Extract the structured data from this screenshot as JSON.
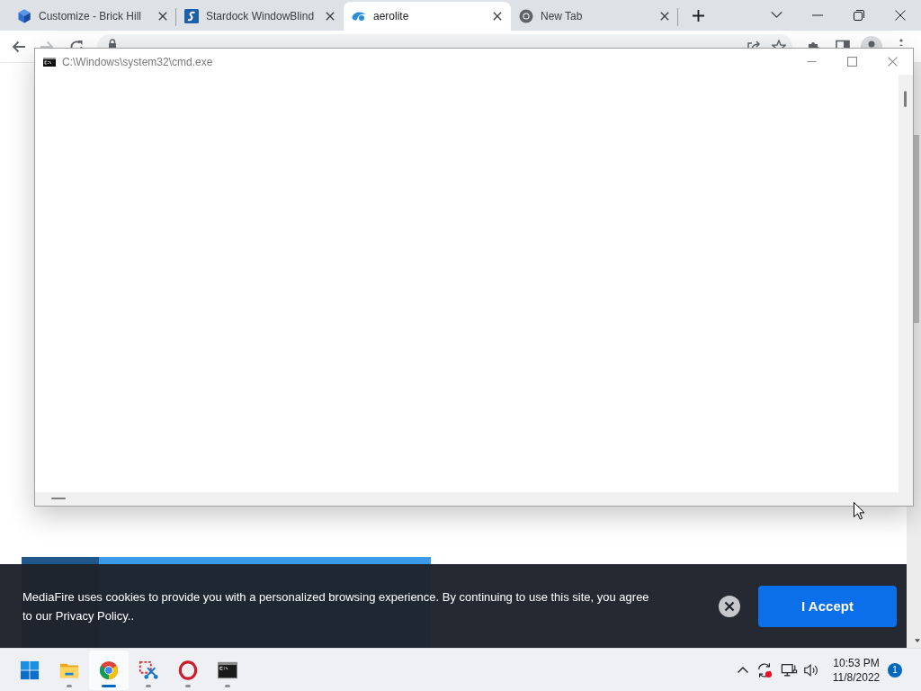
{
  "browser": {
    "tabs": [
      {
        "title": "Customize - Brick Hill",
        "selected": false
      },
      {
        "title": "Stardock WindowBlind",
        "selected": false
      },
      {
        "title": "aerolite",
        "selected": true
      },
      {
        "title": "New Tab",
        "selected": false
      }
    ],
    "forward_disabled": true
  },
  "console_window": {
    "title": "C:\\Windows\\system32\\cmd.exe"
  },
  "cookie_banner": {
    "message": "MediaFire uses cookies to provide you with a personalized browsing experience. By continuing to use this site, you agree to our Privacy Policy..",
    "button": "I Accept"
  },
  "taskbar": {
    "apps": [
      {
        "running": false,
        "selected": false
      },
      {
        "running": true,
        "selected": false
      },
      {
        "running": true,
        "selected": true
      },
      {
        "running": true,
        "selected": false
      },
      {
        "running": true,
        "selected": false
      },
      {
        "running": true,
        "selected": false
      }
    ],
    "time": "10:53 PM",
    "date": "11/8/2022",
    "notifications": "1"
  }
}
